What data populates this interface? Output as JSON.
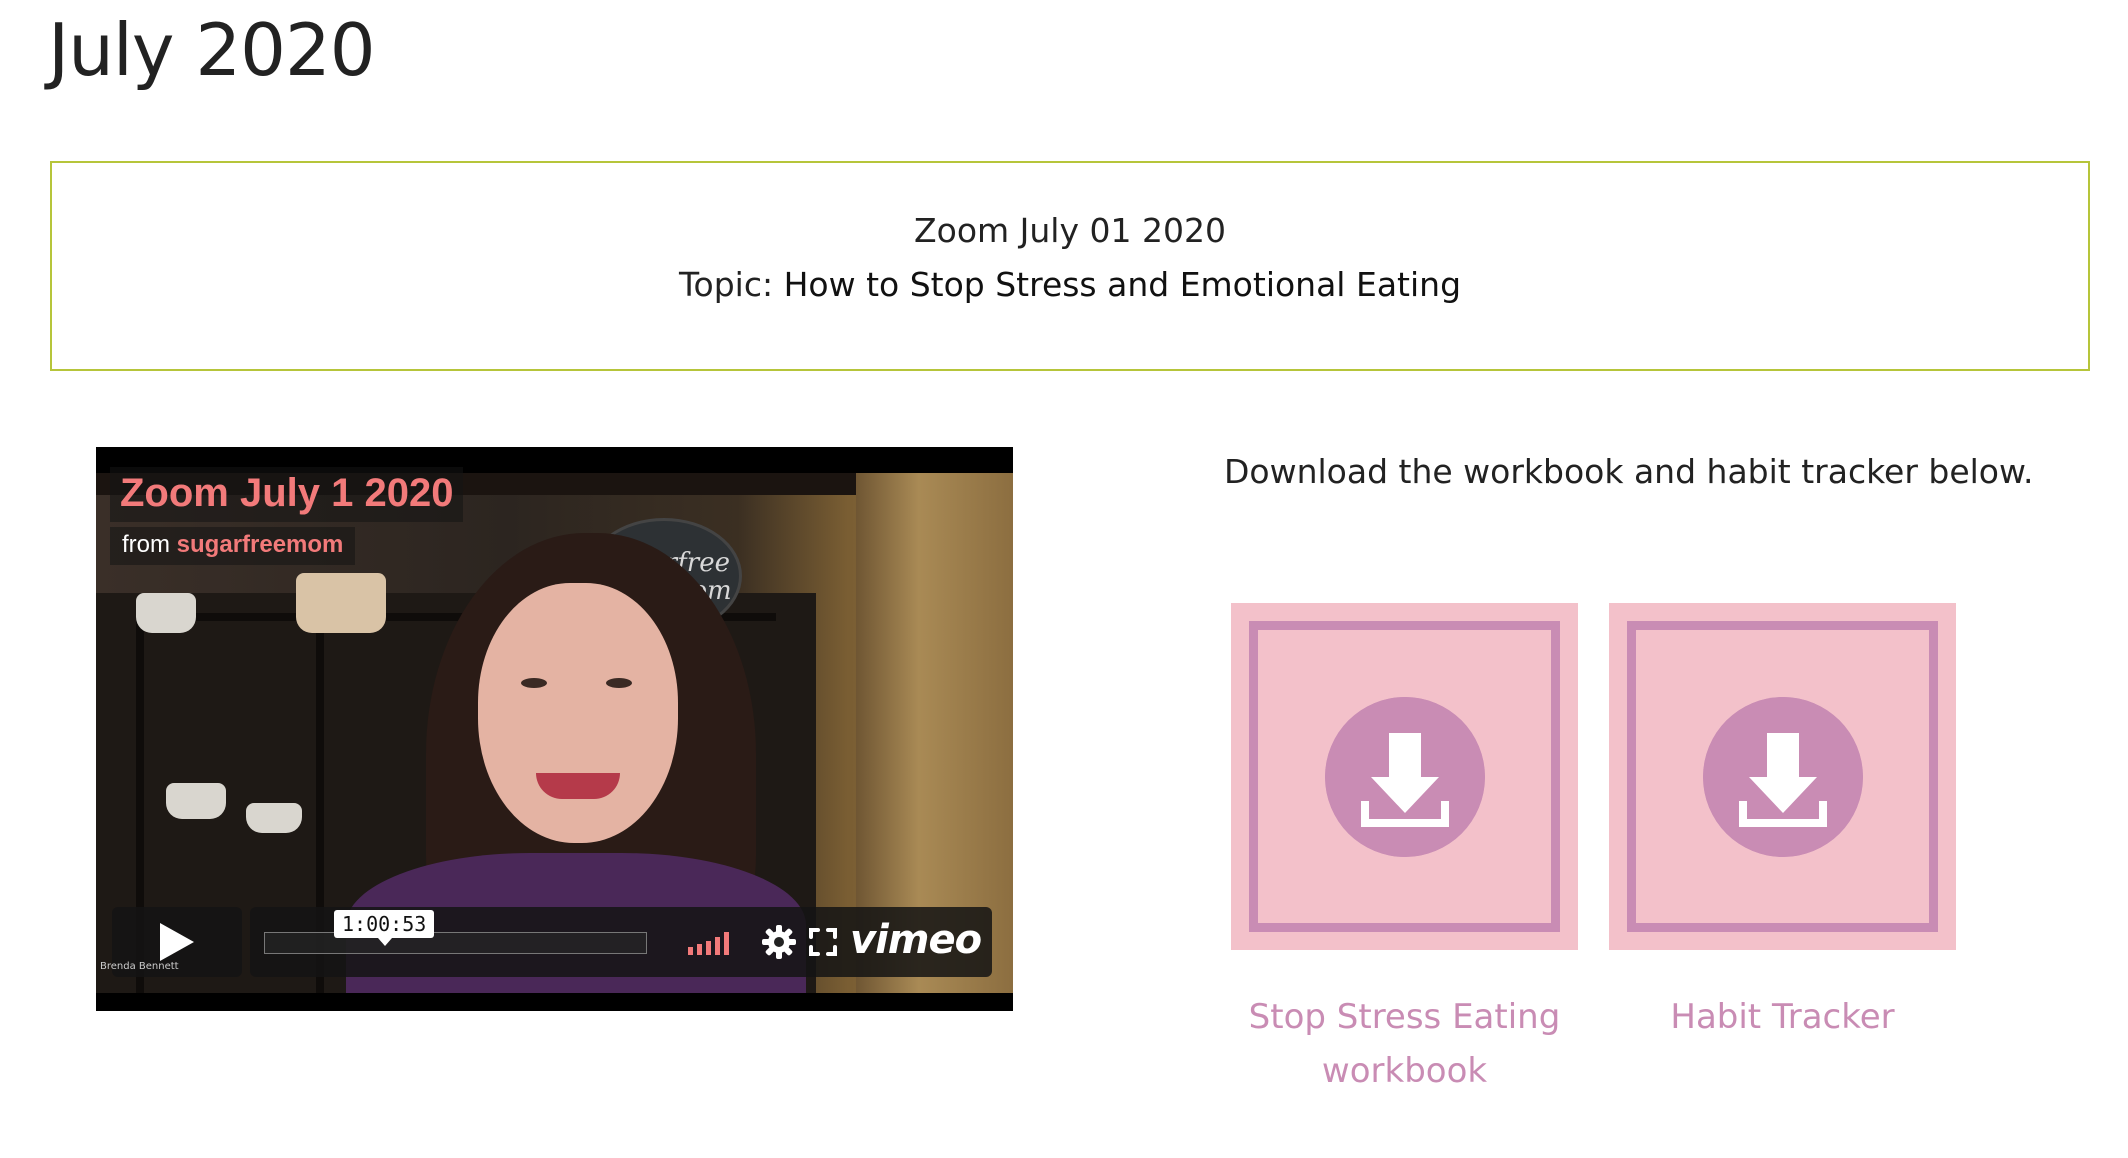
{
  "page": {
    "title": "July 2020"
  },
  "info": {
    "line1": "Zoom July 01 2020",
    "topic_label": "Topic:",
    "topic_text": "How to Stop Stress and Emotional Eating"
  },
  "video": {
    "title": "Zoom July 1 2020",
    "from_label": "from",
    "from_user": "sugarfreemom",
    "timestamp": "1:00:53",
    "progress_fraction": 0.0,
    "logo": "vimeo",
    "sign_text": "Sugarfree Mom.Com",
    "watermark": "Brenda Bennett",
    "icons": [
      "play-icon",
      "volume-icon",
      "gear-icon",
      "fullscreen-icon"
    ]
  },
  "downloads": {
    "intro": "Download the workbook and habit tracker below.",
    "items": [
      {
        "label": "Stop Stress Eating workbook",
        "icon": "download-icon"
      },
      {
        "label": "Habit Tracker",
        "icon": "download-icon"
      }
    ]
  },
  "colors": {
    "box_border": "#b6c53a",
    "tile_bg": "#f3c1ca",
    "tile_accent": "#c98cb4",
    "video_title": "#f27a7a"
  }
}
